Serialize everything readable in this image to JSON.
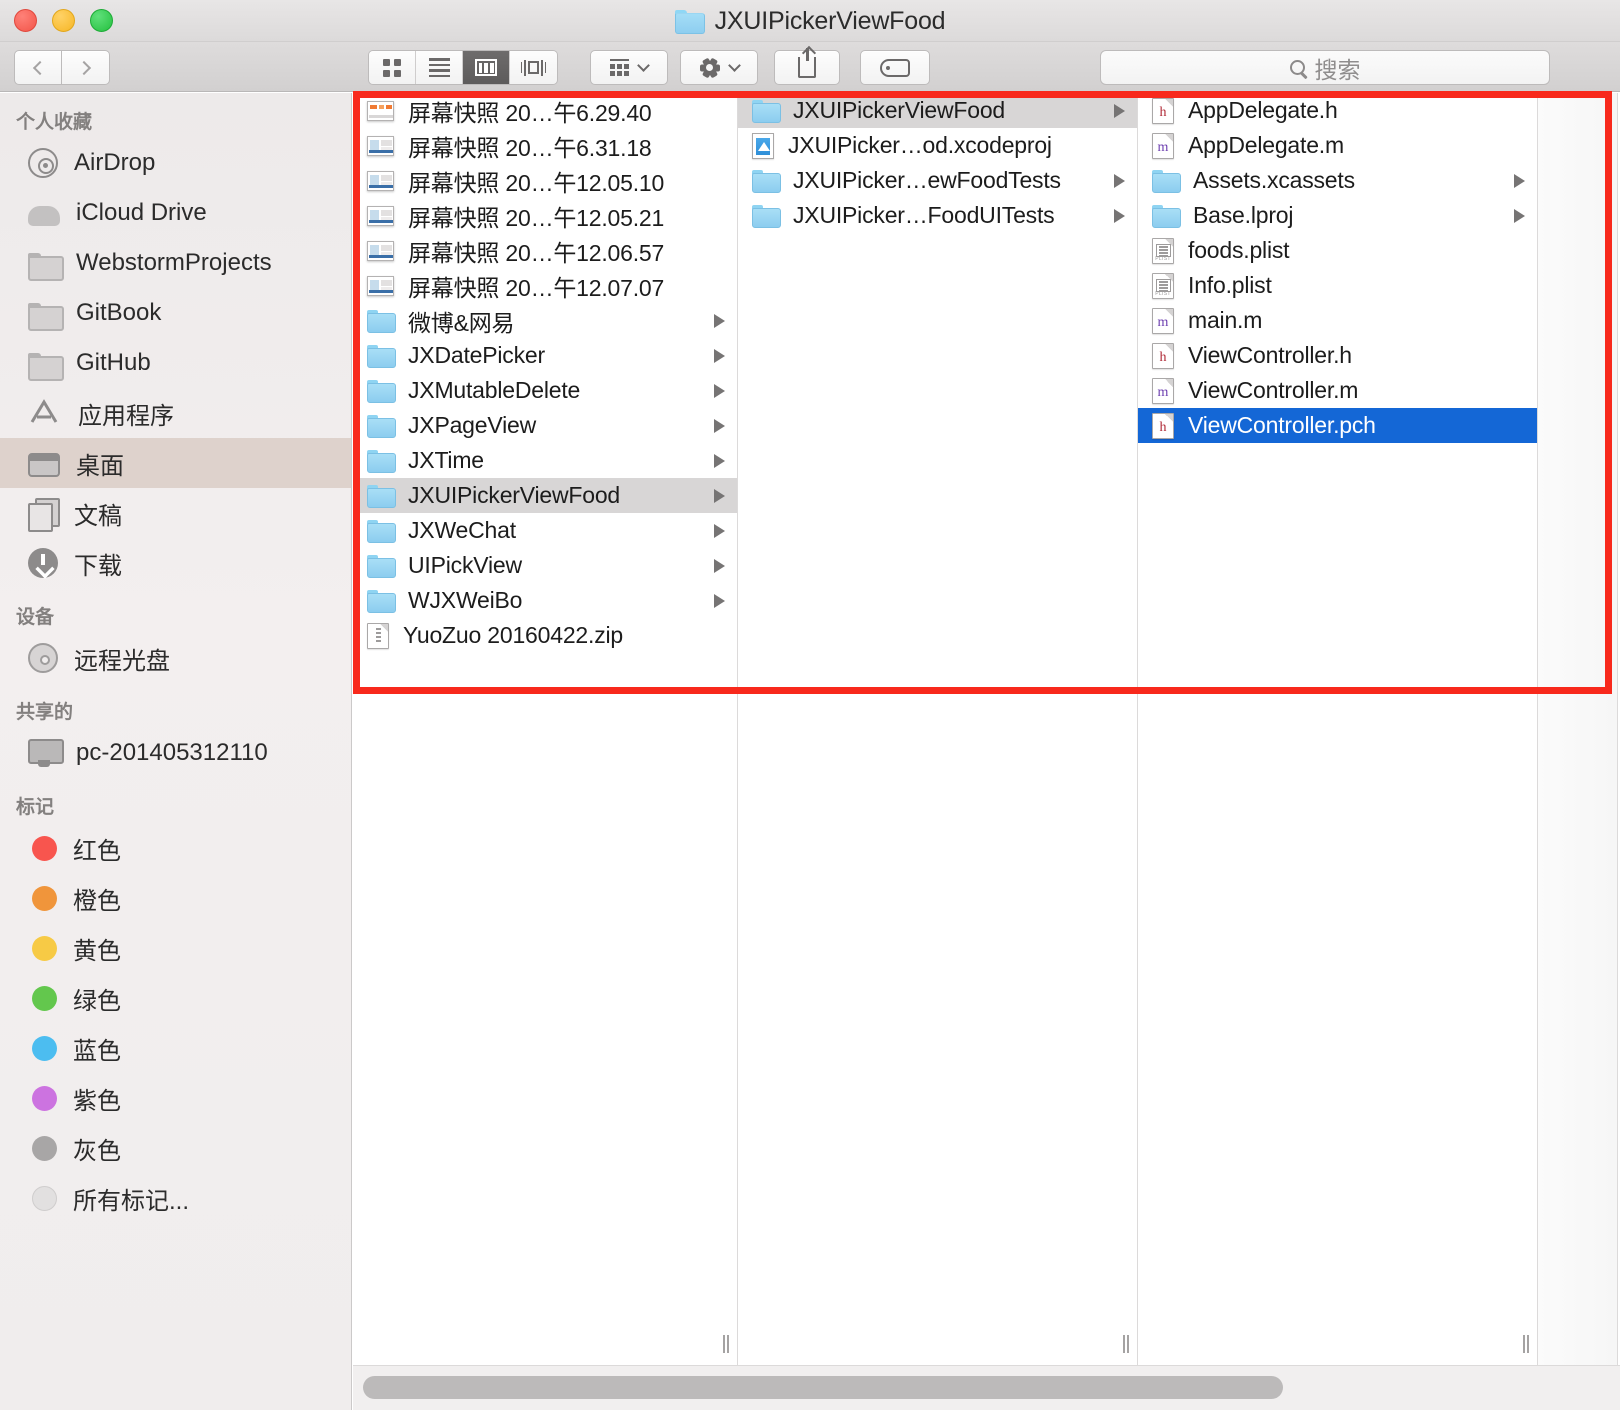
{
  "window": {
    "title": "JXUIPickerViewFood",
    "title_icon": "folder-icon",
    "controls": {
      "close": "close-button",
      "minimize": "minimize-button",
      "zoom": "zoom-button"
    }
  },
  "toolbar": {
    "back_label": "chevron-left-icon",
    "forward_label": "chevron-right-icon",
    "view_modes": [
      {
        "name": "icon-view",
        "icon": "grid-icon",
        "active": false
      },
      {
        "name": "list-view",
        "icon": "list-icon",
        "active": false
      },
      {
        "name": "column-view",
        "icon": "columns-icon",
        "active": true
      },
      {
        "name": "coverflow-view",
        "icon": "coverflow-icon",
        "active": false
      }
    ],
    "arrange_icon": "arrange-icon",
    "action_icon": "gear-icon",
    "share_icon": "share-icon",
    "tag_icon": "tag-icon"
  },
  "search": {
    "placeholder": "搜索",
    "value": "",
    "icon": "search-icon"
  },
  "sidebar": {
    "sections": [
      {
        "heading": "个人收藏",
        "items": [
          {
            "label": "AirDrop",
            "icon": "airdrop-icon",
            "selected": false
          },
          {
            "label": "iCloud Drive",
            "icon": "cloud-icon",
            "selected": false
          },
          {
            "label": "WebstormProjects",
            "icon": "folder-icon",
            "selected": false
          },
          {
            "label": "GitBook",
            "icon": "folder-icon",
            "selected": false
          },
          {
            "label": "GitHub",
            "icon": "folder-icon",
            "selected": false
          },
          {
            "label": "应用程序",
            "icon": "appstore-icon",
            "selected": false
          },
          {
            "label": "桌面",
            "icon": "desktop-icon",
            "selected": true
          },
          {
            "label": "文稿",
            "icon": "documents-icon",
            "selected": false
          },
          {
            "label": "下载",
            "icon": "download-icon",
            "selected": false
          }
        ]
      },
      {
        "heading": "设备",
        "items": [
          {
            "label": "远程光盘",
            "icon": "disc-icon",
            "selected": false
          }
        ]
      },
      {
        "heading": "共享的",
        "items": [
          {
            "label": "pc-201405312110",
            "icon": "pc-icon",
            "selected": false
          }
        ]
      },
      {
        "heading": "标记",
        "items": [
          {
            "label": "红色",
            "icon": "tag-dot",
            "color": "#f8554e",
            "selected": false
          },
          {
            "label": "橙色",
            "icon": "tag-dot",
            "color": "#f0953b",
            "selected": false
          },
          {
            "label": "黄色",
            "icon": "tag-dot",
            "color": "#f7ca45",
            "selected": false
          },
          {
            "label": "绿色",
            "icon": "tag-dot",
            "color": "#63c74d",
            "selected": false
          },
          {
            "label": "蓝色",
            "icon": "tag-dot",
            "color": "#4cbdf0",
            "selected": false
          },
          {
            "label": "紫色",
            "icon": "tag-dot",
            "color": "#cc73e0",
            "selected": false
          },
          {
            "label": "灰色",
            "icon": "tag-dot",
            "color": "#a8a6a6",
            "selected": false
          },
          {
            "label": "所有标记...",
            "icon": "tag-dot",
            "color": "#e2e0e0",
            "selected": false
          }
        ]
      }
    ]
  },
  "columns": [
    {
      "name": "column-1",
      "items": [
        {
          "label": "屏幕快照 20…午6.29.40",
          "icon": "screenshot-icon",
          "arrow": false,
          "selected": "none"
        },
        {
          "label": "屏幕快照 20…午6.31.18",
          "icon": "screenshot-icon",
          "arrow": false,
          "selected": "none"
        },
        {
          "label": "屏幕快照 20…午12.05.10",
          "icon": "screenshot-icon",
          "arrow": false,
          "selected": "none"
        },
        {
          "label": "屏幕快照 20…午12.05.21",
          "icon": "screenshot-icon",
          "arrow": false,
          "selected": "none"
        },
        {
          "label": "屏幕快照 20…午12.06.57",
          "icon": "screenshot-icon",
          "arrow": false,
          "selected": "none"
        },
        {
          "label": "屏幕快照 20…午12.07.07",
          "icon": "screenshot-icon",
          "arrow": false,
          "selected": "none"
        },
        {
          "label": "微博&网易",
          "icon": "folder-icon",
          "arrow": true,
          "selected": "none"
        },
        {
          "label": "JXDatePicker",
          "icon": "folder-icon",
          "arrow": true,
          "selected": "none"
        },
        {
          "label": "JXMutableDelete",
          "icon": "folder-icon",
          "arrow": true,
          "selected": "none"
        },
        {
          "label": "JXPageView",
          "icon": "folder-icon",
          "arrow": true,
          "selected": "none"
        },
        {
          "label": "JXTime",
          "icon": "folder-icon",
          "arrow": true,
          "selected": "none"
        },
        {
          "label": "JXUIPickerViewFood",
          "icon": "folder-icon",
          "arrow": true,
          "selected": "gray"
        },
        {
          "label": "JXWeChat",
          "icon": "folder-icon",
          "arrow": true,
          "selected": "none"
        },
        {
          "label": "UIPickView",
          "icon": "folder-icon",
          "arrow": true,
          "selected": "none"
        },
        {
          "label": "WJXWeiBo",
          "icon": "folder-icon",
          "arrow": true,
          "selected": "none"
        },
        {
          "label": "YuoZuo 20160422.zip",
          "icon": "zip-icon",
          "arrow": false,
          "selected": "none"
        }
      ]
    },
    {
      "name": "column-2",
      "items": [
        {
          "label": "JXUIPickerViewFood",
          "icon": "folder-icon",
          "arrow": true,
          "selected": "gray"
        },
        {
          "label": "JXUIPicker…od.xcodeproj",
          "icon": "xcode-icon",
          "arrow": false,
          "selected": "none"
        },
        {
          "label": "JXUIPicker…ewFoodTests",
          "icon": "folder-icon",
          "arrow": true,
          "selected": "none"
        },
        {
          "label": "JXUIPicker…FoodUITests",
          "icon": "folder-icon",
          "arrow": true,
          "selected": "none"
        }
      ]
    },
    {
      "name": "column-3",
      "items": [
        {
          "label": "AppDelegate.h",
          "icon": "header-file-icon",
          "arrow": false,
          "selected": "none"
        },
        {
          "label": "AppDelegate.m",
          "icon": "source-file-icon",
          "arrow": false,
          "selected": "none"
        },
        {
          "label": "Assets.xcassets",
          "icon": "folder-icon",
          "arrow": true,
          "selected": "none"
        },
        {
          "label": "Base.lproj",
          "icon": "folder-icon",
          "arrow": true,
          "selected": "none"
        },
        {
          "label": "foods.plist",
          "icon": "plist-file-icon",
          "arrow": false,
          "selected": "none"
        },
        {
          "label": "Info.plist",
          "icon": "plist-file-icon",
          "arrow": false,
          "selected": "none"
        },
        {
          "label": "main.m",
          "icon": "source-file-icon",
          "arrow": false,
          "selected": "none"
        },
        {
          "label": "ViewController.h",
          "icon": "header-file-icon",
          "arrow": false,
          "selected": "none"
        },
        {
          "label": "ViewController.m",
          "icon": "source-file-icon",
          "arrow": false,
          "selected": "none"
        },
        {
          "label": "ViewController.pch",
          "icon": "header-file-icon",
          "arrow": false,
          "selected": "blue"
        }
      ]
    }
  ],
  "annotation": {
    "shape": "rectangle",
    "color": "#f8291c"
  },
  "scrollbar": {
    "orientation": "horizontal"
  }
}
